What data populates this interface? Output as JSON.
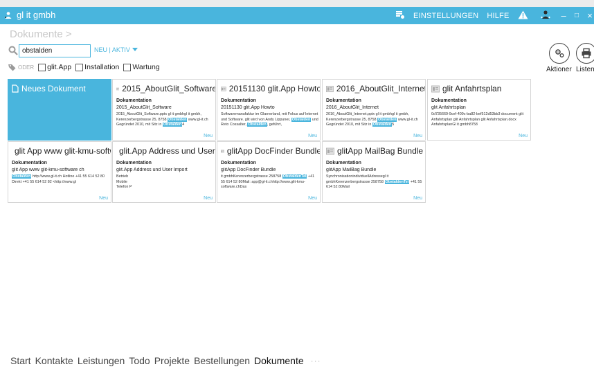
{
  "titlebar": {
    "app_name": "gl it gmbh",
    "settings": "EINSTELLUNGEN",
    "help": "HILFE",
    "minimize": "–",
    "maximize": "□",
    "close": "×"
  },
  "breadcrumb": "Dokumente >",
  "search": {
    "value": "obstalden",
    "filter_mode": "NEU | AKTIV"
  },
  "tags": {
    "operator": "ODER",
    "options": [
      "glit.App",
      "Installation",
      "Wartung"
    ]
  },
  "actions": {
    "aktionen": "Aktioner",
    "listen": "Listen"
  },
  "new_document": "Neues Dokument",
  "tiles": [
    {
      "title": "2015_AboutGlit_Software",
      "type": "Dokumentation",
      "subtitle": "2015_AboutGlit_Software",
      "body_pre": "2015_AboutGlit_Software.pptx gl it gmbhgl it gmbh, Kerenzerbergstrasse 25, 8758 ",
      "hl1": "Obstalden",
      "body_mid": " www.gl-it.ch Gegründet 2010, mit Sitz in ",
      "hl2": "Obstalden",
      "body_post": "4",
      "new": "Neu"
    },
    {
      "title": "20151130 glit.App Howto",
      "type": "Dokumentation",
      "subtitle": "20151130 glit.App Howto",
      "body_pre": "Softwaremanufaktur im Glarnerland, mit Fokus auf Internet und Software. glit wird von Andy Lippuner, ",
      "hl1": "Obstalden",
      "body_mid": " und Reto Cossalter, ",
      "hl2": "Obstalden",
      "body_post": ", geführt,",
      "new": "Neu"
    },
    {
      "title": "2016_AboutGlit_Internet",
      "type": "Dokumentation",
      "subtitle": "2016_AboutGlit_Internet",
      "body_pre": "2016_AboutGlit_Internet.pptx gl it gmbhgl it gmbh, Kerenzerbergstrasse 25, 8758 ",
      "hl1": "Obstalden",
      "body_mid": " www.gl-it.ch Gegründet 2010, mit Sitz in ",
      "hl2": "Obstalden",
      "body_post": "5",
      "new": "Neu"
    },
    {
      "title": "glit Anfahrtsplan",
      "type": "Dokumentation",
      "subtitle": "glit Anfahrtsplan",
      "body_pre": "0d735669-9cef-409c-ba82-bef512d53bb3 document glit Anfahrtsplan glit Anfahrtsplan glit Anfahrtsplan.docx AnfahrtsplanGl it gmbh8758",
      "hl1": "",
      "body_mid": "",
      "hl2": "",
      "body_post": "",
      "new": "Neu"
    },
    {
      "title": "glit App  www glit-kmu-software",
      "type": "Dokumentation",
      "subtitle": " glit App  www glit-kmu-software ch",
      "body_pre": "",
      "hl1": "Obstalden",
      "body_mid": " http://www.gl-it.ch Hotline +41 55 614 52 80 Direkt +41 55 614 52 82 <http://www.gl",
      "hl2": "",
      "body_post": "",
      "new": "Neu"
    },
    {
      "title": "glit.App Address und User Import",
      "type": "Dokumentation",
      "subtitle": "glit.App Address und User Import",
      "body_pre": "Betrieb\nMobile\nTelefon P",
      "hl1": "",
      "body_mid": "",
      "hl2": "",
      "body_post": "",
      "new": "Neu"
    },
    {
      "title": "glitApp DocFinder Bundle",
      "type": "Dokumentation",
      "subtitle": "glitApp DocFinder Bundle",
      "body_pre": "it gmbhKerenzerbergstrasse 258758 ",
      "hl1": "ObstaldenTel",
      "body_mid": " +41 55 614 52 80Mail: app@gl-it.chhttp://www.glit-kmu-software.chDas",
      "hl2": "",
      "body_post": "",
      "new": "Neu"
    },
    {
      "title": "glitApp MailBag Bundle",
      "type": "Dokumentation",
      "subtitle": "glitApp MailBag Bundle",
      "body_pre": "SynchronisationindividuellAdressegl it gmbhKerenzerbergstrasse 258758 ",
      "hl1": "ObstaldenTel",
      "body_mid": " +41 55 614 52 80Mail",
      "hl2": "",
      "body_post": "",
      "new": "Neu"
    }
  ],
  "bottom_nav": {
    "items": [
      "Start",
      "Kontakte",
      "Leistungen",
      "Todo",
      "Projekte",
      "Bestellungen",
      "Dokumente"
    ],
    "more": "···"
  },
  "colors": {
    "accent": "#49b5dd"
  }
}
